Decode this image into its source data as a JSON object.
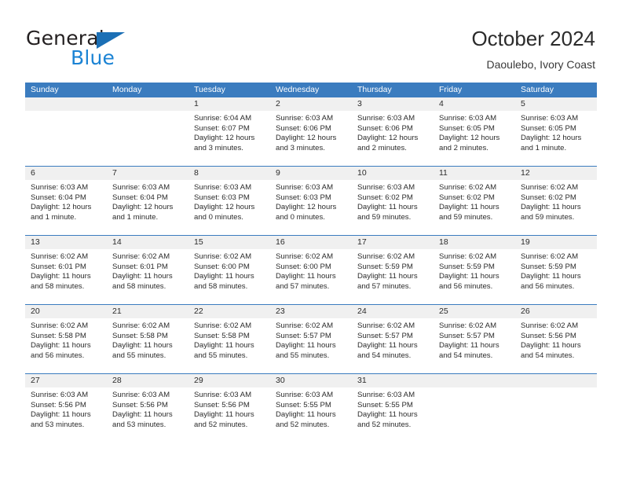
{
  "brand": {
    "name_top": "General",
    "name_bottom": "Blue",
    "triangle_icon": "blue-triangle-icon",
    "color_dark": "#231f20",
    "color_blue": "#1b83d4"
  },
  "header": {
    "title": "October 2024",
    "subtitle": "Daoulebo, Ivory Coast"
  },
  "theme": {
    "header_blue": "#3b7cbf",
    "day_band_gray": "#f0f0f0",
    "text": "#2b2b2b"
  },
  "weekdays": [
    "Sunday",
    "Monday",
    "Tuesday",
    "Wednesday",
    "Thursday",
    "Friday",
    "Saturday"
  ],
  "weeks": [
    [
      {
        "day": "",
        "sunrise": "",
        "sunset": "",
        "daylight": "",
        "daylight2": ""
      },
      {
        "day": "",
        "sunrise": "",
        "sunset": "",
        "daylight": "",
        "daylight2": ""
      },
      {
        "day": "1",
        "sunrise": "Sunrise: 6:04 AM",
        "sunset": "Sunset: 6:07 PM",
        "daylight": "Daylight: 12 hours",
        "daylight2": "and 3 minutes."
      },
      {
        "day": "2",
        "sunrise": "Sunrise: 6:03 AM",
        "sunset": "Sunset: 6:06 PM",
        "daylight": "Daylight: 12 hours",
        "daylight2": "and 3 minutes."
      },
      {
        "day": "3",
        "sunrise": "Sunrise: 6:03 AM",
        "sunset": "Sunset: 6:06 PM",
        "daylight": "Daylight: 12 hours",
        "daylight2": "and 2 minutes."
      },
      {
        "day": "4",
        "sunrise": "Sunrise: 6:03 AM",
        "sunset": "Sunset: 6:05 PM",
        "daylight": "Daylight: 12 hours",
        "daylight2": "and 2 minutes."
      },
      {
        "day": "5",
        "sunrise": "Sunrise: 6:03 AM",
        "sunset": "Sunset: 6:05 PM",
        "daylight": "Daylight: 12 hours",
        "daylight2": "and 1 minute."
      }
    ],
    [
      {
        "day": "6",
        "sunrise": "Sunrise: 6:03 AM",
        "sunset": "Sunset: 6:04 PM",
        "daylight": "Daylight: 12 hours",
        "daylight2": "and 1 minute."
      },
      {
        "day": "7",
        "sunrise": "Sunrise: 6:03 AM",
        "sunset": "Sunset: 6:04 PM",
        "daylight": "Daylight: 12 hours",
        "daylight2": "and 1 minute."
      },
      {
        "day": "8",
        "sunrise": "Sunrise: 6:03 AM",
        "sunset": "Sunset: 6:03 PM",
        "daylight": "Daylight: 12 hours",
        "daylight2": "and 0 minutes."
      },
      {
        "day": "9",
        "sunrise": "Sunrise: 6:03 AM",
        "sunset": "Sunset: 6:03 PM",
        "daylight": "Daylight: 12 hours",
        "daylight2": "and 0 minutes."
      },
      {
        "day": "10",
        "sunrise": "Sunrise: 6:03 AM",
        "sunset": "Sunset: 6:02 PM",
        "daylight": "Daylight: 11 hours",
        "daylight2": "and 59 minutes."
      },
      {
        "day": "11",
        "sunrise": "Sunrise: 6:02 AM",
        "sunset": "Sunset: 6:02 PM",
        "daylight": "Daylight: 11 hours",
        "daylight2": "and 59 minutes."
      },
      {
        "day": "12",
        "sunrise": "Sunrise: 6:02 AM",
        "sunset": "Sunset: 6:02 PM",
        "daylight": "Daylight: 11 hours",
        "daylight2": "and 59 minutes."
      }
    ],
    [
      {
        "day": "13",
        "sunrise": "Sunrise: 6:02 AM",
        "sunset": "Sunset: 6:01 PM",
        "daylight": "Daylight: 11 hours",
        "daylight2": "and 58 minutes."
      },
      {
        "day": "14",
        "sunrise": "Sunrise: 6:02 AM",
        "sunset": "Sunset: 6:01 PM",
        "daylight": "Daylight: 11 hours",
        "daylight2": "and 58 minutes."
      },
      {
        "day": "15",
        "sunrise": "Sunrise: 6:02 AM",
        "sunset": "Sunset: 6:00 PM",
        "daylight": "Daylight: 11 hours",
        "daylight2": "and 58 minutes."
      },
      {
        "day": "16",
        "sunrise": "Sunrise: 6:02 AM",
        "sunset": "Sunset: 6:00 PM",
        "daylight": "Daylight: 11 hours",
        "daylight2": "and 57 minutes."
      },
      {
        "day": "17",
        "sunrise": "Sunrise: 6:02 AM",
        "sunset": "Sunset: 5:59 PM",
        "daylight": "Daylight: 11 hours",
        "daylight2": "and 57 minutes."
      },
      {
        "day": "18",
        "sunrise": "Sunrise: 6:02 AM",
        "sunset": "Sunset: 5:59 PM",
        "daylight": "Daylight: 11 hours",
        "daylight2": "and 56 minutes."
      },
      {
        "day": "19",
        "sunrise": "Sunrise: 6:02 AM",
        "sunset": "Sunset: 5:59 PM",
        "daylight": "Daylight: 11 hours",
        "daylight2": "and 56 minutes."
      }
    ],
    [
      {
        "day": "20",
        "sunrise": "Sunrise: 6:02 AM",
        "sunset": "Sunset: 5:58 PM",
        "daylight": "Daylight: 11 hours",
        "daylight2": "and 56 minutes."
      },
      {
        "day": "21",
        "sunrise": "Sunrise: 6:02 AM",
        "sunset": "Sunset: 5:58 PM",
        "daylight": "Daylight: 11 hours",
        "daylight2": "and 55 minutes."
      },
      {
        "day": "22",
        "sunrise": "Sunrise: 6:02 AM",
        "sunset": "Sunset: 5:58 PM",
        "daylight": "Daylight: 11 hours",
        "daylight2": "and 55 minutes."
      },
      {
        "day": "23",
        "sunrise": "Sunrise: 6:02 AM",
        "sunset": "Sunset: 5:57 PM",
        "daylight": "Daylight: 11 hours",
        "daylight2": "and 55 minutes."
      },
      {
        "day": "24",
        "sunrise": "Sunrise: 6:02 AM",
        "sunset": "Sunset: 5:57 PM",
        "daylight": "Daylight: 11 hours",
        "daylight2": "and 54 minutes."
      },
      {
        "day": "25",
        "sunrise": "Sunrise: 6:02 AM",
        "sunset": "Sunset: 5:57 PM",
        "daylight": "Daylight: 11 hours",
        "daylight2": "and 54 minutes."
      },
      {
        "day": "26",
        "sunrise": "Sunrise: 6:02 AM",
        "sunset": "Sunset: 5:56 PM",
        "daylight": "Daylight: 11 hours",
        "daylight2": "and 54 minutes."
      }
    ],
    [
      {
        "day": "27",
        "sunrise": "Sunrise: 6:03 AM",
        "sunset": "Sunset: 5:56 PM",
        "daylight": "Daylight: 11 hours",
        "daylight2": "and 53 minutes."
      },
      {
        "day": "28",
        "sunrise": "Sunrise: 6:03 AM",
        "sunset": "Sunset: 5:56 PM",
        "daylight": "Daylight: 11 hours",
        "daylight2": "and 53 minutes."
      },
      {
        "day": "29",
        "sunrise": "Sunrise: 6:03 AM",
        "sunset": "Sunset: 5:56 PM",
        "daylight": "Daylight: 11 hours",
        "daylight2": "and 52 minutes."
      },
      {
        "day": "30",
        "sunrise": "Sunrise: 6:03 AM",
        "sunset": "Sunset: 5:55 PM",
        "daylight": "Daylight: 11 hours",
        "daylight2": "and 52 minutes."
      },
      {
        "day": "31",
        "sunrise": "Sunrise: 6:03 AM",
        "sunset": "Sunset: 5:55 PM",
        "daylight": "Daylight: 11 hours",
        "daylight2": "and 52 minutes."
      },
      {
        "day": "",
        "sunrise": "",
        "sunset": "",
        "daylight": "",
        "daylight2": ""
      },
      {
        "day": "",
        "sunrise": "",
        "sunset": "",
        "daylight": "",
        "daylight2": ""
      }
    ]
  ]
}
